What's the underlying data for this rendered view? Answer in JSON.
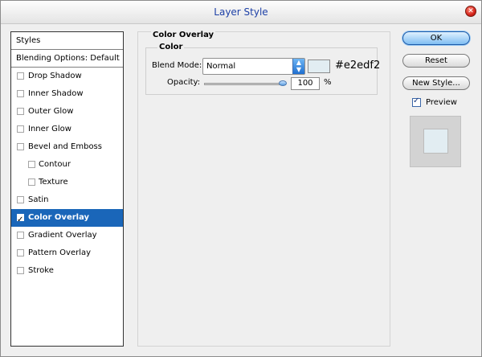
{
  "window": {
    "title": "Layer Style"
  },
  "styles_panel": {
    "header": "Styles",
    "blending": "Blending Options: Default",
    "items": [
      {
        "label": "Drop Shadow"
      },
      {
        "label": "Inner Shadow"
      },
      {
        "label": "Outer Glow"
      },
      {
        "label": "Inner Glow"
      },
      {
        "label": "Bevel and Emboss"
      },
      {
        "label": "Contour"
      },
      {
        "label": "Texture"
      },
      {
        "label": "Satin"
      },
      {
        "label": "Color Overlay"
      },
      {
        "label": "Gradient Overlay"
      },
      {
        "label": "Pattern Overlay"
      },
      {
        "label": "Stroke"
      }
    ]
  },
  "overlay": {
    "section_title": "Color Overlay",
    "group_title": "Color",
    "blend_mode_label": "Blend Mode:",
    "blend_mode_value": "Normal",
    "color_hex": "#e2edf2",
    "opacity_label": "Opacity:",
    "opacity_value": "100",
    "opacity_unit": "%"
  },
  "buttons": {
    "ok": "OK",
    "reset": "Reset",
    "new_style": "New Style...",
    "preview": "Preview"
  },
  "colors": {
    "overlay_color": "#e2edf2",
    "selection": "#1a66b9"
  },
  "icons": [
    "close-icon",
    "dropdown-arrow-icon",
    "checkbox-checked-icon"
  ]
}
